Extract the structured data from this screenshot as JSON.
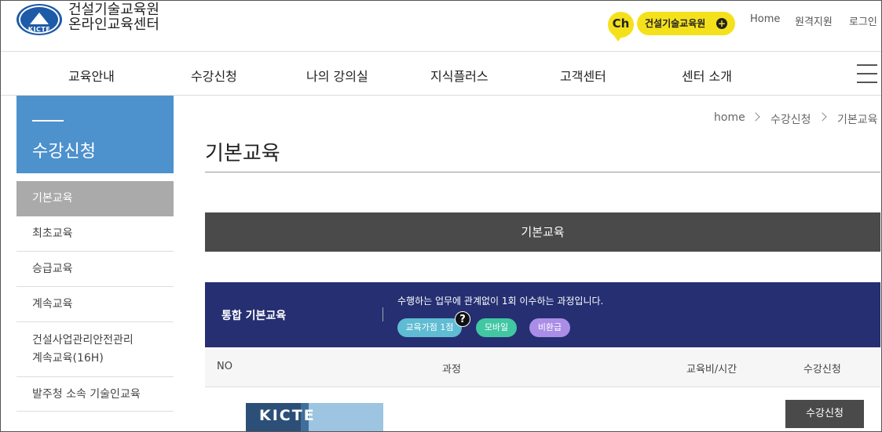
{
  "header": {
    "logo_small": "건설교육",
    "logo_letters": "KICTE",
    "org_line1": "건설기술교육원",
    "org_line2": "온라인교육센터",
    "ch_badge": "Ch",
    "channel_button": "건설기술교육원",
    "util_links": [
      "Home",
      "원격지원",
      "로그인"
    ]
  },
  "nav": {
    "items": [
      "교육안내",
      "수강신청",
      "나의 강의실",
      "지식플러스",
      "고객센터",
      "센터 소개"
    ]
  },
  "sidebar": {
    "title": "수강신청",
    "items": [
      {
        "label": "기본교육",
        "active": true
      },
      {
        "label": "최초교육"
      },
      {
        "label": "승급교육"
      },
      {
        "label": "계속교육"
      },
      {
        "label_line1": "건설사업관리안전관리",
        "label_line2": "계속교육(16H)"
      },
      {
        "label": "발주청 소속 기술인교육"
      }
    ]
  },
  "breadcrumb": [
    "home",
    "수강신청",
    "기본교육"
  ],
  "page_title": "기본교육",
  "section_title": "기본교육",
  "course": {
    "name": "통합 기본교육",
    "description": "수행하는 업무에 관계없이 1회 이수하는 과정입니다.",
    "tags": [
      {
        "label": "교육가점 1점",
        "color": "#5fbcd3"
      },
      {
        "label": "모바일",
        "color": "#41c7a2"
      },
      {
        "label": "비환급",
        "color": "#a98de6"
      }
    ],
    "help_icon": "?"
  },
  "table": {
    "headers": [
      "NO",
      "과정",
      "교육비/시간",
      "수강신청"
    ]
  },
  "row": {
    "thumb_text": "KICTE",
    "enroll_button": "수강신청"
  },
  "colors": {
    "sidebar_head": "#4d91cd",
    "course_box": "#252f72",
    "section_bar": "#4a4a4a",
    "accent_yellow": "#f5e11b"
  }
}
